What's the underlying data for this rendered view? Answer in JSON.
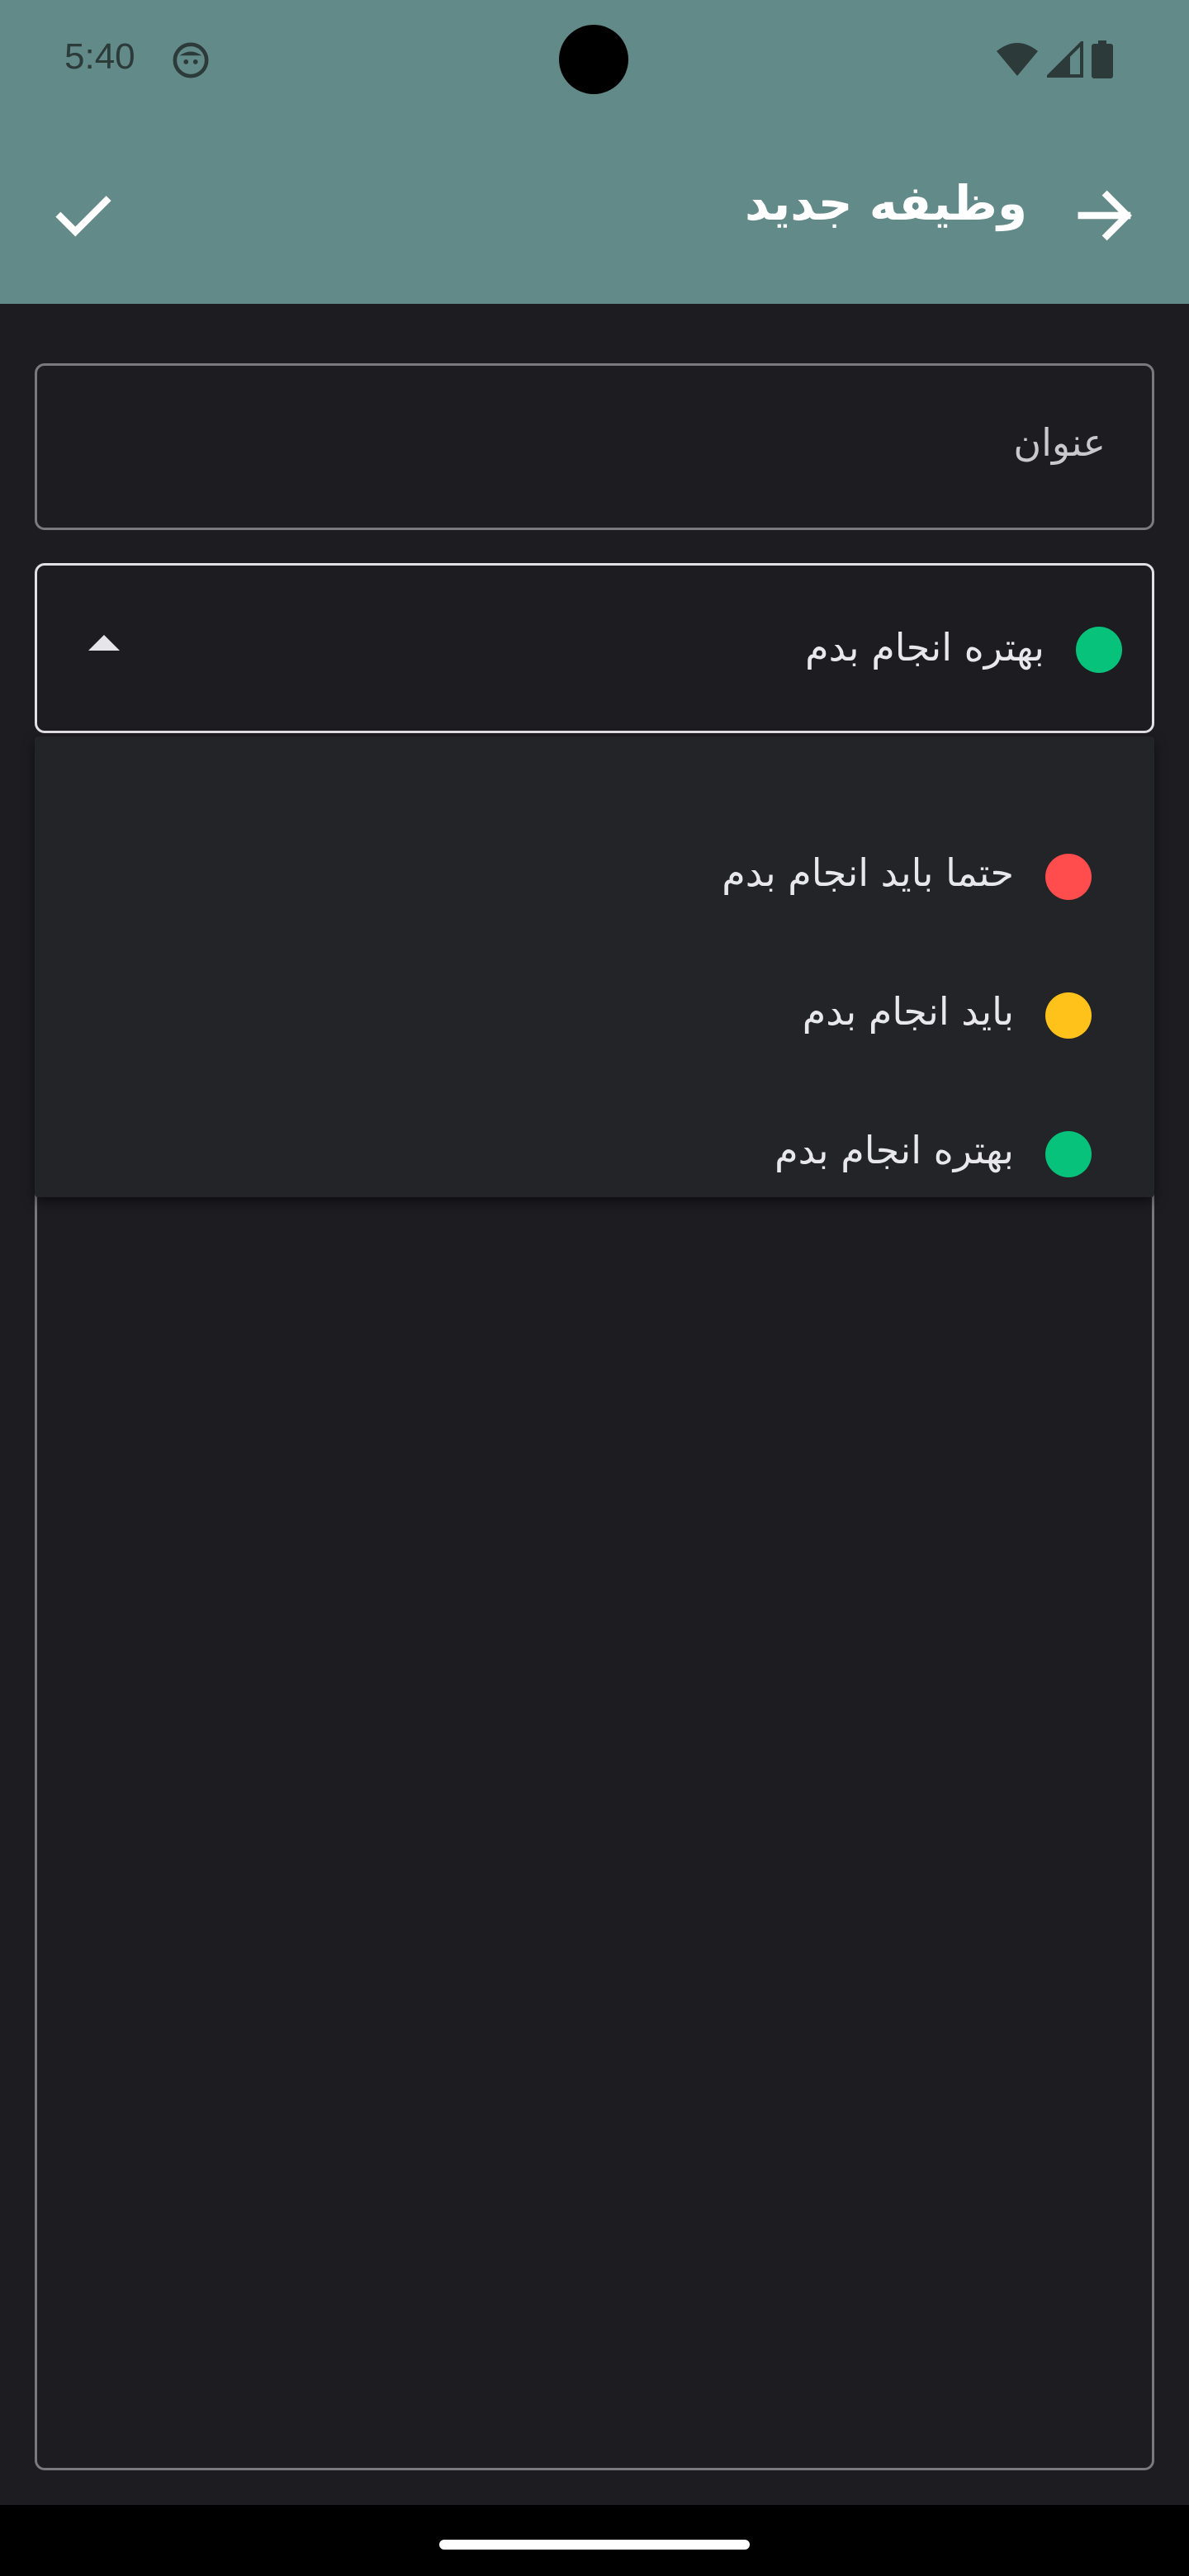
{
  "status_bar": {
    "time": "5:40"
  },
  "app_bar": {
    "title": "وظیفه جدید"
  },
  "form": {
    "title_placeholder": "عنوان",
    "priority": {
      "selected_label": "بهتره انجام بدم",
      "selected_color": "#07c27b"
    }
  },
  "priority_menu": {
    "items": [
      {
        "label": "حتما باید انجام بدم",
        "color": "#ff4c4c"
      },
      {
        "label": "باید انجام بدم",
        "color": "#ffc21a"
      },
      {
        "label": "بهتره انجام بدم",
        "color": "#07c27b"
      }
    ]
  },
  "colors": {
    "app_bar": "#628a89",
    "background": "#1d1c21",
    "menu_background": "#232428"
  }
}
